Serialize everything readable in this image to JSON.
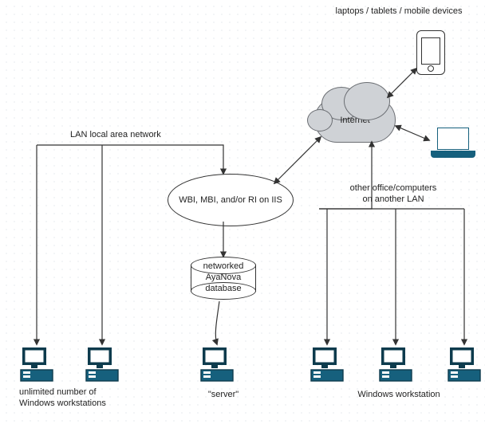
{
  "header_label": "laptops / tablets / mobile devices",
  "cloud_label": "Internet",
  "lan_label": "LAN local area network",
  "iis_label": "WBI, MBI, and/or RI\non IIS",
  "db_label": "networked\nAyaNova database",
  "other_lan_label": "other office/computers\non another LAN",
  "left_caption": "unlimited number of\nWindows workstations",
  "center_caption": "\"server\"",
  "right_caption": "Windows workstation"
}
